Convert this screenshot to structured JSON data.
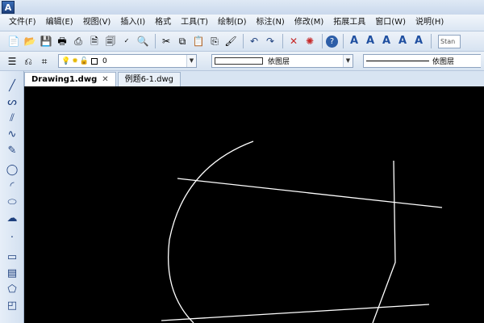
{
  "window": {
    "logo_letter": "A"
  },
  "menu": [
    "文件(F)",
    "编辑(E)",
    "视图(V)",
    "插入(I)",
    "格式",
    "工具(T)",
    "绘制(D)",
    "标注(N)",
    "修改(M)",
    "拓展工具",
    "窗口(W)",
    "说明(H)"
  ],
  "toolbar1": {
    "icons": [
      "new-icon",
      "open-icon",
      "save-icon",
      "print-preview-icon",
      "print-icon",
      "publish-icon",
      "plot-icon",
      "spell-check-icon",
      "find-icon",
      "cut-icon",
      "copy-icon",
      "paste-icon",
      "match-properties-icon",
      "undo-icon",
      "redo-icon",
      "delete-icon",
      "explode-icon",
      "help-icon",
      "text-style-icon",
      "text-icon",
      "text-edit-icon",
      "text-find-icon",
      "text-scale-icon"
    ],
    "text_buttons": [
      "A",
      "A",
      "A",
      "A",
      "A"
    ],
    "style_box": "Stan"
  },
  "toolbar2": {
    "layer_value": "0",
    "color_label": "依图层",
    "linetype_label": "依图层"
  },
  "tabs": [
    {
      "label": "Drawing1.dwg",
      "active": true
    },
    {
      "label": "例题6-1.dwg",
      "active": false
    }
  ],
  "lefttoolbar_icons": [
    "line-icon",
    "polyline-icon",
    "construction-line-icon",
    "spline-icon",
    "freehand-icon",
    "circle-icon",
    "arc-icon",
    "ellipse-icon",
    "revcloud-icon",
    "point-icon",
    "rectangle-icon",
    "hatch-icon",
    "polygon-icon",
    "region-icon"
  ],
  "colors": {
    "canvas_bg": "#000000",
    "drawing_line": "#ffffff"
  }
}
